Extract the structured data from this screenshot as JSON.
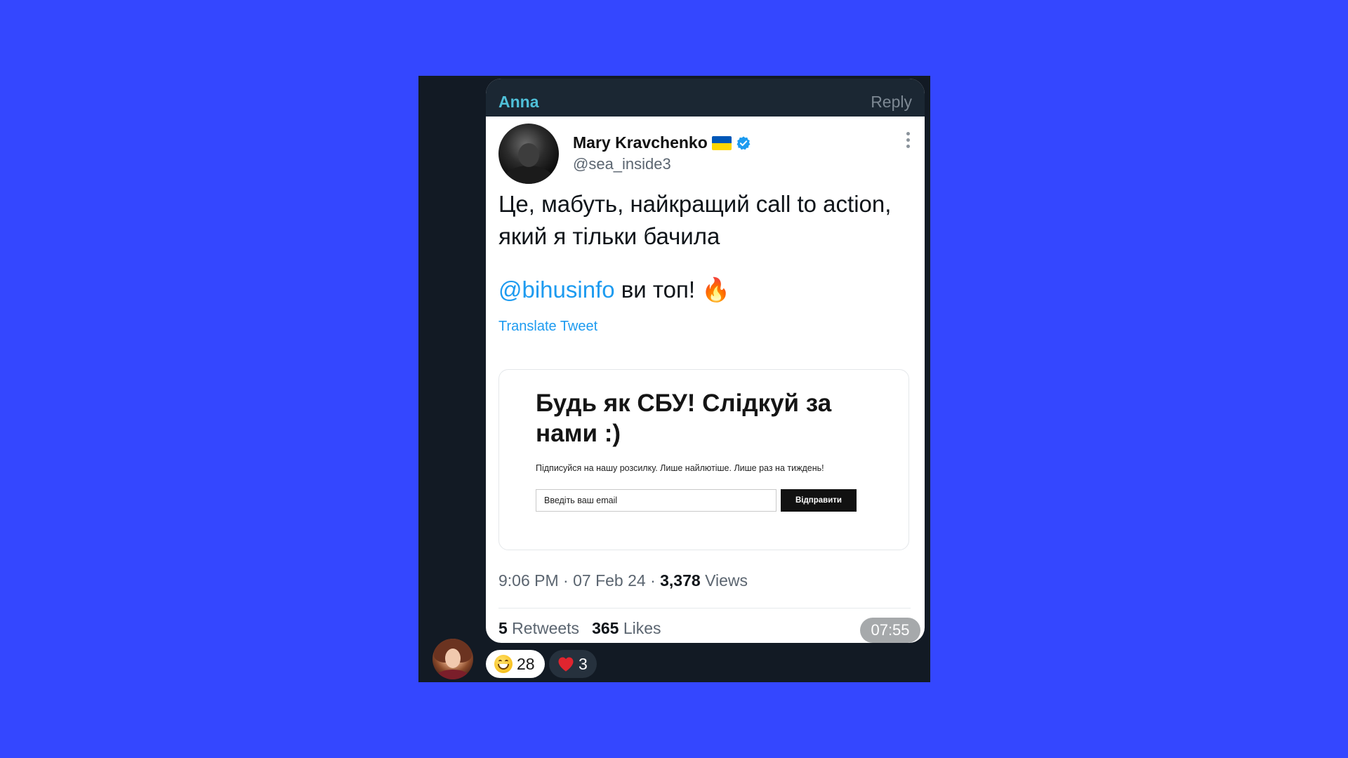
{
  "message": {
    "sender": "Anna",
    "reply_label": "Reply",
    "time": "07:55"
  },
  "tweet": {
    "author_name": "Mary Kravchenko",
    "handle": "@sea_inside3",
    "text_line1": "Це, мабуть, найкращий call to action, який я тільки бачила",
    "mention": "@bihusinfo",
    "text_line2_rest": " ви топ! ",
    "fire_emoji": "🔥",
    "translate_label": "Translate Tweet",
    "timestamp": "9:06 PM · 07 Feb 24 · ",
    "views_count": "3,378",
    "views_label": " Views",
    "retweets_count": "5",
    "retweets_label": " Retweets",
    "likes_count": "365",
    "likes_label": " Likes"
  },
  "embed": {
    "title": "Будь як СБУ! Слідкуй за нами :)",
    "subtitle": "Підписуйся на нашу розсилку. Лише найлютіше. Лише раз на тиждень!",
    "input_placeholder": "Введіть ваш email",
    "button_label": "Відправити"
  },
  "reactions": [
    {
      "emoji": "grinning-face",
      "count": "28"
    },
    {
      "emoji": "red-heart",
      "count": "3"
    }
  ],
  "colors": {
    "background": "#3447ff",
    "panel": "#121a24",
    "sender": "#4fc0d8",
    "link": "#1d9bf0"
  }
}
